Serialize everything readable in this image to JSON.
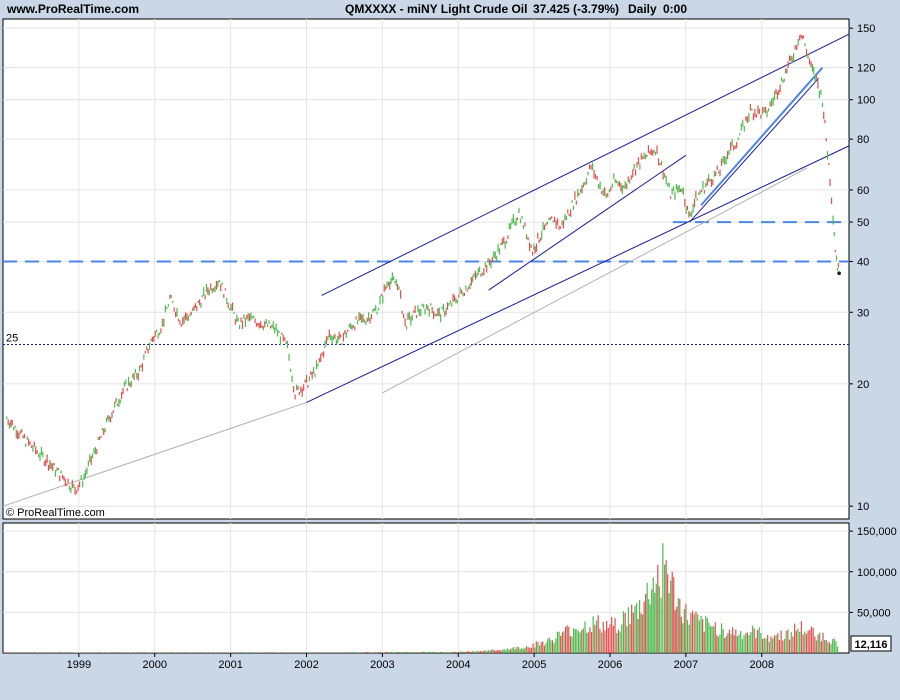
{
  "header": {
    "site": "www.ProRealTime.com",
    "title": "QMXXXX - miNY Light Crude Oil",
    "price": "37.425 (-3.79%)",
    "period": "Daily",
    "time": "0:00"
  },
  "watermark": "© ProRealTime.com",
  "colors": {
    "up": "#4dbb4d",
    "down": "#e05050",
    "trendline": "#1a1a9c",
    "support": "#4a86e8",
    "panel_bg": "#ffffff",
    "frame_bg": "#c9d7e6"
  },
  "chart_data": [
    {
      "type": "line",
      "title": "QMXXXX - miNY Light Crude Oil",
      "scale": "log",
      "ylim": [
        9.3,
        158
      ],
      "yticks": [
        10,
        20,
        30,
        40,
        50,
        60,
        80,
        100,
        120,
        150
      ],
      "xlabels": [
        "1999",
        "2000",
        "2001",
        "2002",
        "2003",
        "2004",
        "2005",
        "2006",
        "2007",
        "2008"
      ],
      "grid": true,
      "series": [
        {
          "values": [
            [
              1998.05,
              16.5
            ],
            [
              1998.3,
              14.5
            ],
            [
              1998.6,
              12.8
            ],
            [
              1998.95,
              11.0
            ],
            [
              1999.05,
              11.6
            ],
            [
              1999.2,
              13.5
            ],
            [
              1999.4,
              16.5
            ],
            [
              1999.6,
              19.5
            ],
            [
              1999.8,
              21.5
            ],
            [
              1999.95,
              25.5
            ],
            [
              2000.1,
              28.0
            ],
            [
              2000.2,
              32.5
            ],
            [
              2000.35,
              28.5
            ],
            [
              2000.5,
              30.0
            ],
            [
              2000.7,
              34.0
            ],
            [
              2000.85,
              36.0
            ],
            [
              2000.95,
              32.5
            ],
            [
              2001.1,
              28.0
            ],
            [
              2001.25,
              29.0
            ],
            [
              2001.45,
              28.0
            ],
            [
              2001.6,
              27.2
            ],
            [
              2001.75,
              24.5
            ],
            [
              2001.85,
              19.0
            ],
            [
              2002.0,
              20.0
            ],
            [
              2002.15,
              22.0
            ],
            [
              2002.3,
              26.5
            ],
            [
              2002.45,
              25.5
            ],
            [
              2002.6,
              28.0
            ],
            [
              2002.8,
              29.0
            ],
            [
              2002.95,
              31.0
            ],
            [
              2003.08,
              36.0
            ],
            [
              2003.2,
              35.5
            ],
            [
              2003.3,
              28.0
            ],
            [
              2003.45,
              30.0
            ],
            [
              2003.6,
              31.0
            ],
            [
              2003.75,
              29.5
            ],
            [
              2003.95,
              32.0
            ],
            [
              2004.1,
              34.5
            ],
            [
              2004.3,
              38.0
            ],
            [
              2004.45,
              40.5
            ],
            [
              2004.6,
              44.5
            ],
            [
              2004.8,
              53.0
            ],
            [
              2004.9,
              47.0
            ],
            [
              2004.98,
              42.5
            ],
            [
              2005.1,
              47.0
            ],
            [
              2005.25,
              51.0
            ],
            [
              2005.35,
              48.5
            ],
            [
              2005.5,
              55.0
            ],
            [
              2005.65,
              62.0
            ],
            [
              2005.75,
              68.5
            ],
            [
              2005.85,
              62.5
            ],
            [
              2005.95,
              57.5
            ],
            [
              2006.05,
              63.0
            ],
            [
              2006.2,
              61.0
            ],
            [
              2006.3,
              67.0
            ],
            [
              2006.45,
              72.0
            ],
            [
              2006.6,
              76.0
            ],
            [
              2006.7,
              67.0
            ],
            [
              2006.8,
              58.5
            ],
            [
              2006.95,
              61.0
            ],
            [
              2007.04,
              51.5
            ],
            [
              2007.15,
              58.0
            ],
            [
              2007.3,
              63.0
            ],
            [
              2007.45,
              67.0
            ],
            [
              2007.55,
              74.0
            ],
            [
              2007.65,
              78.0
            ],
            [
              2007.75,
              85.0
            ],
            [
              2007.85,
              94.0
            ],
            [
              2007.95,
              93.0
            ],
            [
              2008.05,
              92.0
            ],
            [
              2008.15,
              100.0
            ],
            [
              2008.28,
              113.0
            ],
            [
              2008.4,
              127.0
            ],
            [
              2008.5,
              145.0
            ],
            [
              2008.55,
              141.0
            ],
            [
              2008.65,
              120.0
            ],
            [
              2008.72,
              112.0
            ],
            [
              2008.8,
              100.0
            ],
            [
              2008.85,
              80.0
            ],
            [
              2008.9,
              64.0
            ],
            [
              2008.94,
              52.0
            ],
            [
              2008.97,
              43.0
            ],
            [
              2009.0,
              39.0
            ],
            [
              2009.02,
              37.425
            ]
          ]
        }
      ],
      "horizontal_levels": [
        25,
        40,
        50
      ],
      "level_labels": [
        "25",
        "40",
        "50"
      ]
    },
    {
      "type": "bar",
      "title": "Volume",
      "ylim": [
        0,
        160000
      ],
      "yticks": [
        50000,
        100000,
        150000
      ],
      "ytick_labels": [
        "50,000",
        "100,000",
        "150,000"
      ],
      "last_value_label": "12,116",
      "series": [
        {
          "values": [
            [
              1998.0,
              500
            ],
            [
              2002.0,
              700
            ],
            [
              2004.0,
              1500
            ],
            [
              2004.5,
              4000
            ],
            [
              2004.9,
              9000
            ],
            [
              2005.2,
              18000
            ],
            [
              2005.5,
              35000
            ],
            [
              2005.8,
              42000
            ],
            [
              2006.0,
              38000
            ],
            [
              2006.2,
              50000
            ],
            [
              2006.35,
              60000
            ],
            [
              2006.45,
              75000
            ],
            [
              2006.55,
              95000
            ],
            [
              2006.65,
              115000
            ],
            [
              2006.72,
              130000
            ],
            [
              2006.8,
              100000
            ],
            [
              2006.9,
              70000
            ],
            [
              2007.0,
              55000
            ],
            [
              2007.2,
              42000
            ],
            [
              2007.45,
              35000
            ],
            [
              2007.7,
              28000
            ],
            [
              2007.9,
              30000
            ],
            [
              2008.1,
              24000
            ],
            [
              2008.3,
              26000
            ],
            [
              2008.5,
              36000
            ],
            [
              2008.7,
              28000
            ],
            [
              2008.85,
              22000
            ],
            [
              2009.02,
              12116
            ]
          ]
        }
      ]
    }
  ]
}
